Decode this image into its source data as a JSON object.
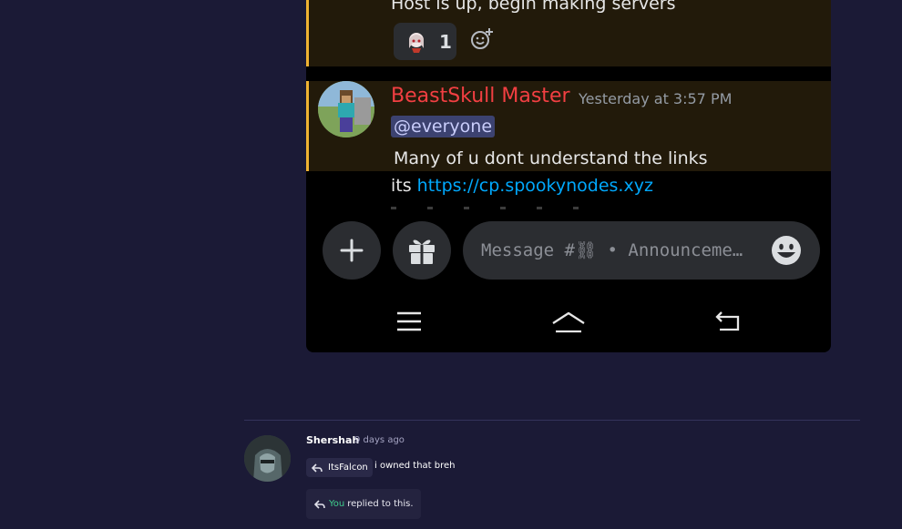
{
  "phone": {
    "message1": {
      "text": "Host is up, begin making servers",
      "reaction_count": "1"
    },
    "message2": {
      "author": "BeastSkull Master",
      "timestamp": "Yesterday at 3:57 PM",
      "mention": "@everyone",
      "line1": "Many of u dont understand the links",
      "line2_prefix": "its ",
      "link": "https://cp.spookynodes.xyz"
    },
    "composer": {
      "placeholder": "Message #⛓ • Announceme…"
    },
    "icons": [
      "plus-icon",
      "gift-icon",
      "emoji-icon",
      "menu-icon",
      "home-icon",
      "back-icon",
      "add-reaction-icon"
    ]
  },
  "comment": {
    "author": "Shershah",
    "time": "9 days ago",
    "reply_to": "ItsFalcon",
    "text": "i owned that breh",
    "replied_you": "You",
    "replied_rest": "replied to this."
  },
  "colors": {
    "page_bg": "#1b1a36",
    "author_red": "#f23f42",
    "link_blue": "#00a8fc",
    "you_green": "#3ecf8e",
    "highlight_border": "#f0b232"
  }
}
